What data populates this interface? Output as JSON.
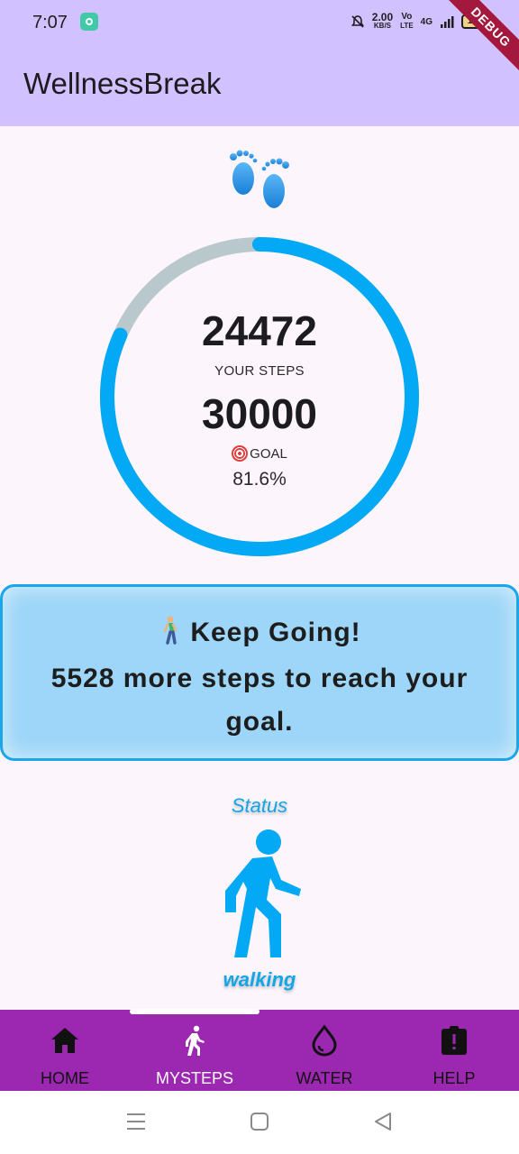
{
  "status_bar": {
    "time": "7:07",
    "net_speed_value": "2.00",
    "net_speed_unit": "KB/S",
    "volte_top": "Vo",
    "volte_bottom": "LTE",
    "network": "4G",
    "battery": "100",
    "debug_banner": "DEBUG"
  },
  "app_bar": {
    "title": "WellnessBreak"
  },
  "progress": {
    "steps": "24472",
    "steps_label": "YOUR STEPS",
    "goal": "30000",
    "goal_label": "GOAL",
    "percent_text": "81.6%",
    "fraction": 0.816,
    "progress_color": "#03a9f4",
    "track_color": "#b9c8cd"
  },
  "card": {
    "line1": "Keep Going!",
    "line2": "5528 more steps to reach your goal.",
    "background": "#9dd6f8",
    "border": "#1ba6ea"
  },
  "status": {
    "title": "Status",
    "value": "walking",
    "icon": "directions-walk-icon"
  },
  "bottom_nav": {
    "active_index": 1,
    "items": [
      {
        "label": "HOME",
        "icon": "home-icon"
      },
      {
        "label": "MYSTEPS",
        "icon": "walk-icon"
      },
      {
        "label": "WATER",
        "icon": "water-drop-icon"
      },
      {
        "label": "HELP",
        "icon": "help-clipboard-icon"
      }
    ]
  }
}
